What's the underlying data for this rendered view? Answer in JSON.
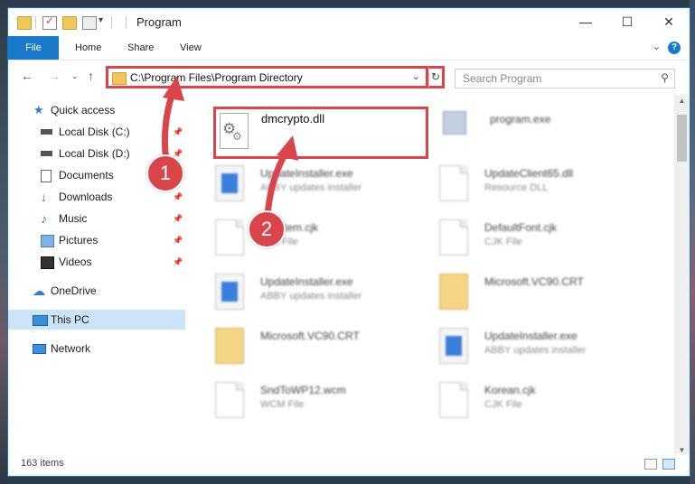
{
  "window": {
    "title": "Program"
  },
  "ribbon": {
    "tabs": [
      "File",
      "Home",
      "Share",
      "View"
    ],
    "help_glyph": "?"
  },
  "nav": {
    "address": "C:\\Program Files\\Program Directory",
    "search_placeholder": "Search Program"
  },
  "sidebar": {
    "items": [
      {
        "label": "Quick access",
        "icon": "star-icon"
      },
      {
        "label": "Local Disk (C:)",
        "icon": "drive-icon",
        "pinned": true
      },
      {
        "label": "Local Disk (D:)",
        "icon": "drive-icon",
        "pinned": true
      },
      {
        "label": "Documents",
        "icon": "documents-icon",
        "pinned": true
      },
      {
        "label": "Downloads",
        "icon": "downloads-icon",
        "pinned": true
      },
      {
        "label": "Music",
        "icon": "music-icon",
        "pinned": true
      },
      {
        "label": "Pictures",
        "icon": "pictures-icon",
        "pinned": true
      },
      {
        "label": "Videos",
        "icon": "videos-icon",
        "pinned": true
      },
      {
        "label": "OneDrive",
        "icon": "onedrive-icon"
      },
      {
        "label": "This PC",
        "icon": "pc-icon",
        "selected": true
      },
      {
        "label": "Network",
        "icon": "network-icon"
      }
    ]
  },
  "files": [
    {
      "name": "dmcrypto.dll",
      "type": "",
      "icon": "dll-gear-icon",
      "highlighted": true
    },
    {
      "name": "program.exe",
      "type": "",
      "icon": "exe-icon"
    },
    {
      "name": "UpdateInstaller.exe",
      "type": "ABBY updates installer",
      "icon": "installer-icon"
    },
    {
      "name": "UpdateClient65.dll",
      "type": "Resource DLL",
      "icon": "dll-icon"
    },
    {
      "name": "Asystem.cjk",
      "type": "CJK File",
      "icon": "document-icon"
    },
    {
      "name": "DefaultFont.cjk",
      "type": "CJK File",
      "icon": "document-icon"
    },
    {
      "name": "UpdateInstaller.exe",
      "type": "ABBY updates installer",
      "icon": "installer-icon"
    },
    {
      "name": "Microsoft.VC90.CRT",
      "type": "",
      "icon": "folder-icon"
    },
    {
      "name": "Microsoft.VC90.CRT",
      "type": "",
      "icon": "folder-icon"
    },
    {
      "name": "UpdateInstaller.exe",
      "type": "ABBY updates installer",
      "icon": "installer-icon"
    },
    {
      "name": "SndToWP12.wcm",
      "type": "WCM File",
      "icon": "document-icon"
    },
    {
      "name": "Korean.cjk",
      "type": "CJK File",
      "icon": "document-icon"
    }
  ],
  "status": {
    "items_count": "163 items"
  },
  "callouts": {
    "step1": "1",
    "step2": "2"
  },
  "colors": {
    "accent": "#1979ca",
    "callout": "#d9454a",
    "selection": "#cce4f7"
  }
}
